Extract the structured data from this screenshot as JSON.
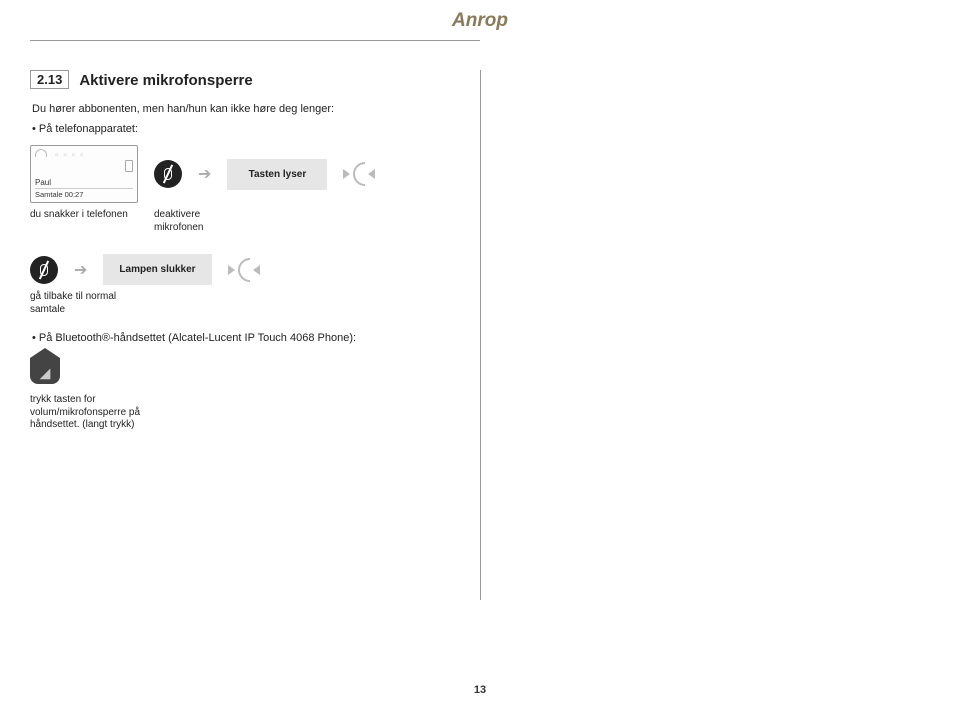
{
  "header": {
    "title": "Anrop"
  },
  "section": {
    "number": "2.13",
    "title": "Aktivere mikrofonsperre",
    "intro": "Du hører abbonenten, men han/hun kan ikke høre deg lenger:",
    "bullet_device": "• På telefonapparatet:",
    "bullet_headset": "• På Bluetooth®-håndsettet (Alcatel-Lucent IP Touch 4068 Phone):"
  },
  "phone": {
    "name": "Paul",
    "status": "Samtale 00:27"
  },
  "row1": {
    "caption_screen": "du snakker i telefonen",
    "caption_mute": "deaktivere mikrofonen",
    "status_box": "Tasten lyser"
  },
  "row2": {
    "caption_mute": "gå tilbake til normal samtale",
    "status_box": "Lampen slukker"
  },
  "bt": {
    "caption": "trykk tasten for volum/mikrofonsperre på håndsettet. (langt trykk)"
  },
  "page_number": "13"
}
